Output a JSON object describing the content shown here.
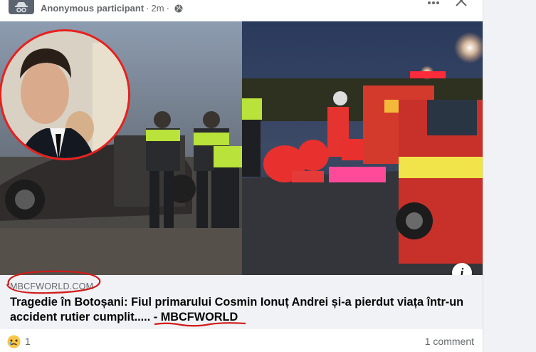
{
  "post": {
    "author": "Anonymous participant",
    "separator": "·",
    "time": "2m",
    "more_label": "...",
    "close_label": "Close"
  },
  "link_preview": {
    "domain": "MBCFWORLD.COM",
    "headline": "Tragedie în Botoșani: Fiul primarului Cosmin Ionuț Andrei și-a pierdut viața într-un accident rutier cumplit..... - MBCFWORLD",
    "info_label": "i"
  },
  "footer": {
    "reaction_icon": "sad-emoji-icon",
    "reaction_count": "1",
    "comment_count": "1 comment"
  },
  "colors": {
    "accent_annotation": "#d11a1a",
    "secondary_text": "#65676b",
    "link_bg": "#f0f2f5"
  }
}
